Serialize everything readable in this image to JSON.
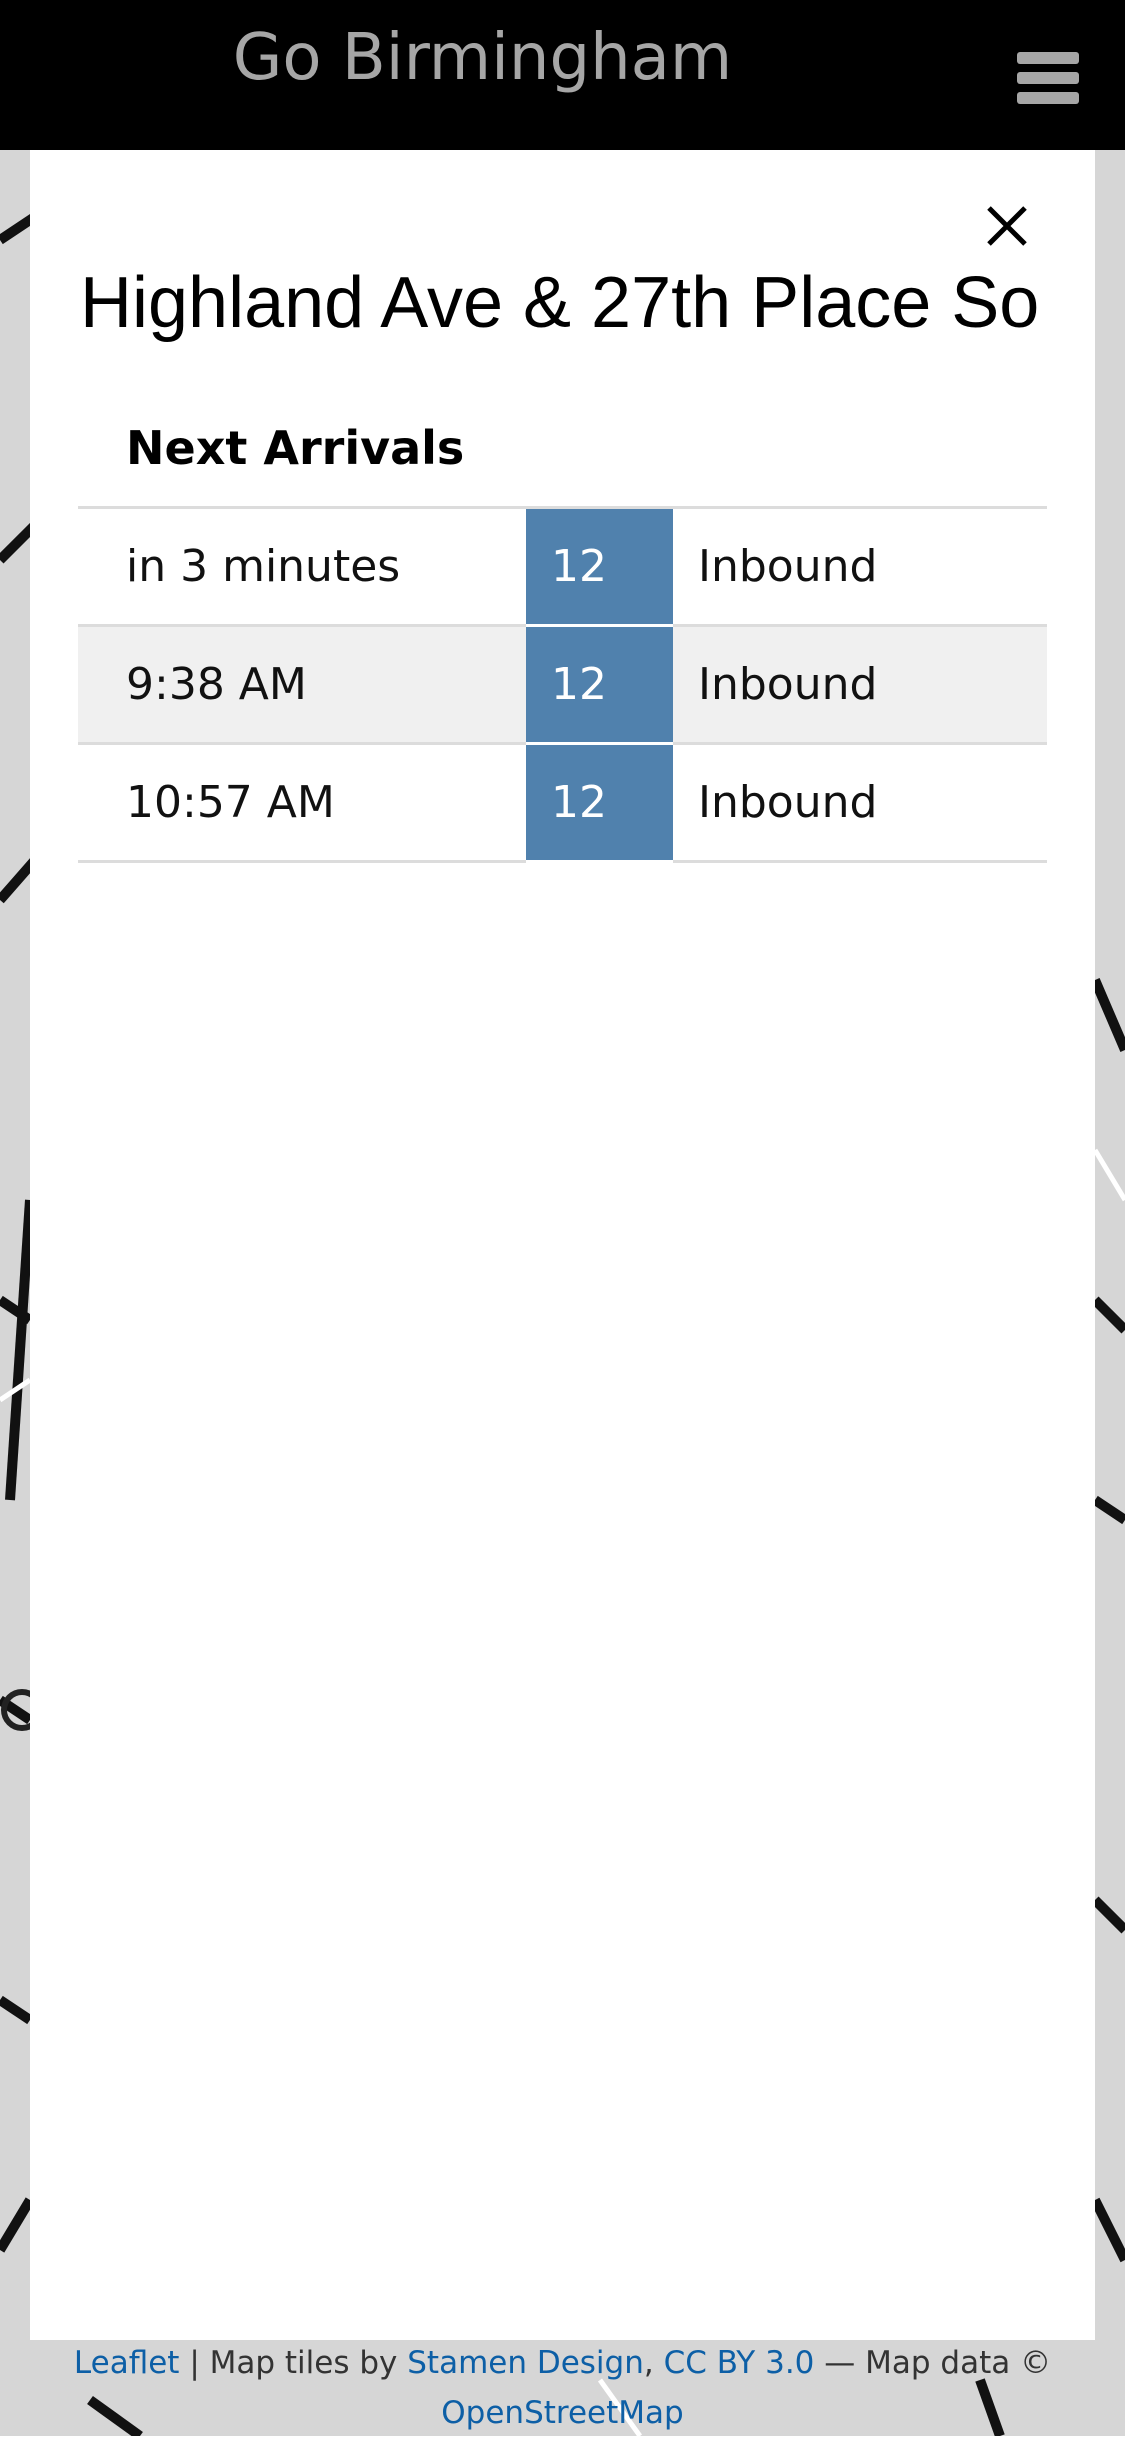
{
  "header": {
    "title": "Go Birmingham"
  },
  "modal": {
    "stop_name": "Highland Ave & 27th Place So",
    "table_heading": "Next Arrivals",
    "arrivals": [
      {
        "time": "in 3 minutes",
        "route": "12",
        "direction": "Inbound"
      },
      {
        "time": "9:38 AM",
        "route": "12",
        "direction": "Inbound"
      },
      {
        "time": "10:57 AM",
        "route": "12",
        "direction": "Inbound"
      }
    ]
  },
  "attribution": {
    "leaflet": "Leaflet",
    "sep1": " | Map tiles by ",
    "stamen": "Stamen Design",
    "sep2": ", ",
    "license": "CC BY 3.0",
    "sep3": " — Map data © ",
    "osm": "OpenStreetMap"
  },
  "colors": {
    "header_bg": "#000000",
    "route_badge": "#5081ad",
    "link": "#0d5fa6"
  }
}
